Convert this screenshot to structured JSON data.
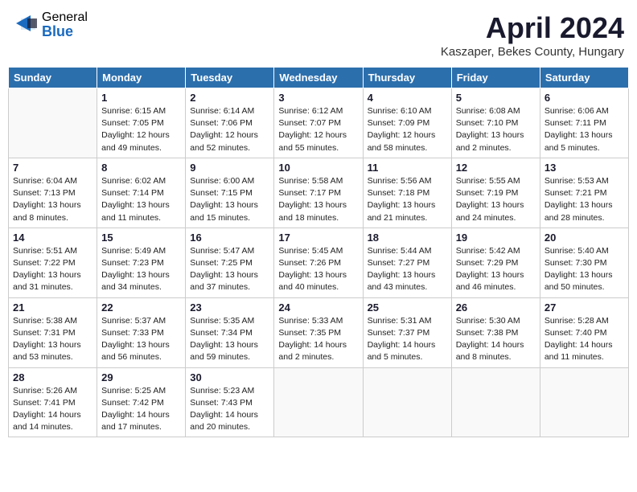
{
  "header": {
    "logo_general": "General",
    "logo_blue": "Blue",
    "title": "April 2024",
    "location": "Kaszaper, Bekes County, Hungary"
  },
  "weekdays": [
    "Sunday",
    "Monday",
    "Tuesday",
    "Wednesday",
    "Thursday",
    "Friday",
    "Saturday"
  ],
  "weeks": [
    [
      {
        "day": "",
        "info": ""
      },
      {
        "day": "1",
        "info": "Sunrise: 6:15 AM\nSunset: 7:05 PM\nDaylight: 12 hours\nand 49 minutes."
      },
      {
        "day": "2",
        "info": "Sunrise: 6:14 AM\nSunset: 7:06 PM\nDaylight: 12 hours\nand 52 minutes."
      },
      {
        "day": "3",
        "info": "Sunrise: 6:12 AM\nSunset: 7:07 PM\nDaylight: 12 hours\nand 55 minutes."
      },
      {
        "day": "4",
        "info": "Sunrise: 6:10 AM\nSunset: 7:09 PM\nDaylight: 12 hours\nand 58 minutes."
      },
      {
        "day": "5",
        "info": "Sunrise: 6:08 AM\nSunset: 7:10 PM\nDaylight: 13 hours\nand 2 minutes."
      },
      {
        "day": "6",
        "info": "Sunrise: 6:06 AM\nSunset: 7:11 PM\nDaylight: 13 hours\nand 5 minutes."
      }
    ],
    [
      {
        "day": "7",
        "info": "Sunrise: 6:04 AM\nSunset: 7:13 PM\nDaylight: 13 hours\nand 8 minutes."
      },
      {
        "day": "8",
        "info": "Sunrise: 6:02 AM\nSunset: 7:14 PM\nDaylight: 13 hours\nand 11 minutes."
      },
      {
        "day": "9",
        "info": "Sunrise: 6:00 AM\nSunset: 7:15 PM\nDaylight: 13 hours\nand 15 minutes."
      },
      {
        "day": "10",
        "info": "Sunrise: 5:58 AM\nSunset: 7:17 PM\nDaylight: 13 hours\nand 18 minutes."
      },
      {
        "day": "11",
        "info": "Sunrise: 5:56 AM\nSunset: 7:18 PM\nDaylight: 13 hours\nand 21 minutes."
      },
      {
        "day": "12",
        "info": "Sunrise: 5:55 AM\nSunset: 7:19 PM\nDaylight: 13 hours\nand 24 minutes."
      },
      {
        "day": "13",
        "info": "Sunrise: 5:53 AM\nSunset: 7:21 PM\nDaylight: 13 hours\nand 28 minutes."
      }
    ],
    [
      {
        "day": "14",
        "info": "Sunrise: 5:51 AM\nSunset: 7:22 PM\nDaylight: 13 hours\nand 31 minutes."
      },
      {
        "day": "15",
        "info": "Sunrise: 5:49 AM\nSunset: 7:23 PM\nDaylight: 13 hours\nand 34 minutes."
      },
      {
        "day": "16",
        "info": "Sunrise: 5:47 AM\nSunset: 7:25 PM\nDaylight: 13 hours\nand 37 minutes."
      },
      {
        "day": "17",
        "info": "Sunrise: 5:45 AM\nSunset: 7:26 PM\nDaylight: 13 hours\nand 40 minutes."
      },
      {
        "day": "18",
        "info": "Sunrise: 5:44 AM\nSunset: 7:27 PM\nDaylight: 13 hours\nand 43 minutes."
      },
      {
        "day": "19",
        "info": "Sunrise: 5:42 AM\nSunset: 7:29 PM\nDaylight: 13 hours\nand 46 minutes."
      },
      {
        "day": "20",
        "info": "Sunrise: 5:40 AM\nSunset: 7:30 PM\nDaylight: 13 hours\nand 50 minutes."
      }
    ],
    [
      {
        "day": "21",
        "info": "Sunrise: 5:38 AM\nSunset: 7:31 PM\nDaylight: 13 hours\nand 53 minutes."
      },
      {
        "day": "22",
        "info": "Sunrise: 5:37 AM\nSunset: 7:33 PM\nDaylight: 13 hours\nand 56 minutes."
      },
      {
        "day": "23",
        "info": "Sunrise: 5:35 AM\nSunset: 7:34 PM\nDaylight: 13 hours\nand 59 minutes."
      },
      {
        "day": "24",
        "info": "Sunrise: 5:33 AM\nSunset: 7:35 PM\nDaylight: 14 hours\nand 2 minutes."
      },
      {
        "day": "25",
        "info": "Sunrise: 5:31 AM\nSunset: 7:37 PM\nDaylight: 14 hours\nand 5 minutes."
      },
      {
        "day": "26",
        "info": "Sunrise: 5:30 AM\nSunset: 7:38 PM\nDaylight: 14 hours\nand 8 minutes."
      },
      {
        "day": "27",
        "info": "Sunrise: 5:28 AM\nSunset: 7:40 PM\nDaylight: 14 hours\nand 11 minutes."
      }
    ],
    [
      {
        "day": "28",
        "info": "Sunrise: 5:26 AM\nSunset: 7:41 PM\nDaylight: 14 hours\nand 14 minutes."
      },
      {
        "day": "29",
        "info": "Sunrise: 5:25 AM\nSunset: 7:42 PM\nDaylight: 14 hours\nand 17 minutes."
      },
      {
        "day": "30",
        "info": "Sunrise: 5:23 AM\nSunset: 7:43 PM\nDaylight: 14 hours\nand 20 minutes."
      },
      {
        "day": "",
        "info": ""
      },
      {
        "day": "",
        "info": ""
      },
      {
        "day": "",
        "info": ""
      },
      {
        "day": "",
        "info": ""
      }
    ]
  ]
}
